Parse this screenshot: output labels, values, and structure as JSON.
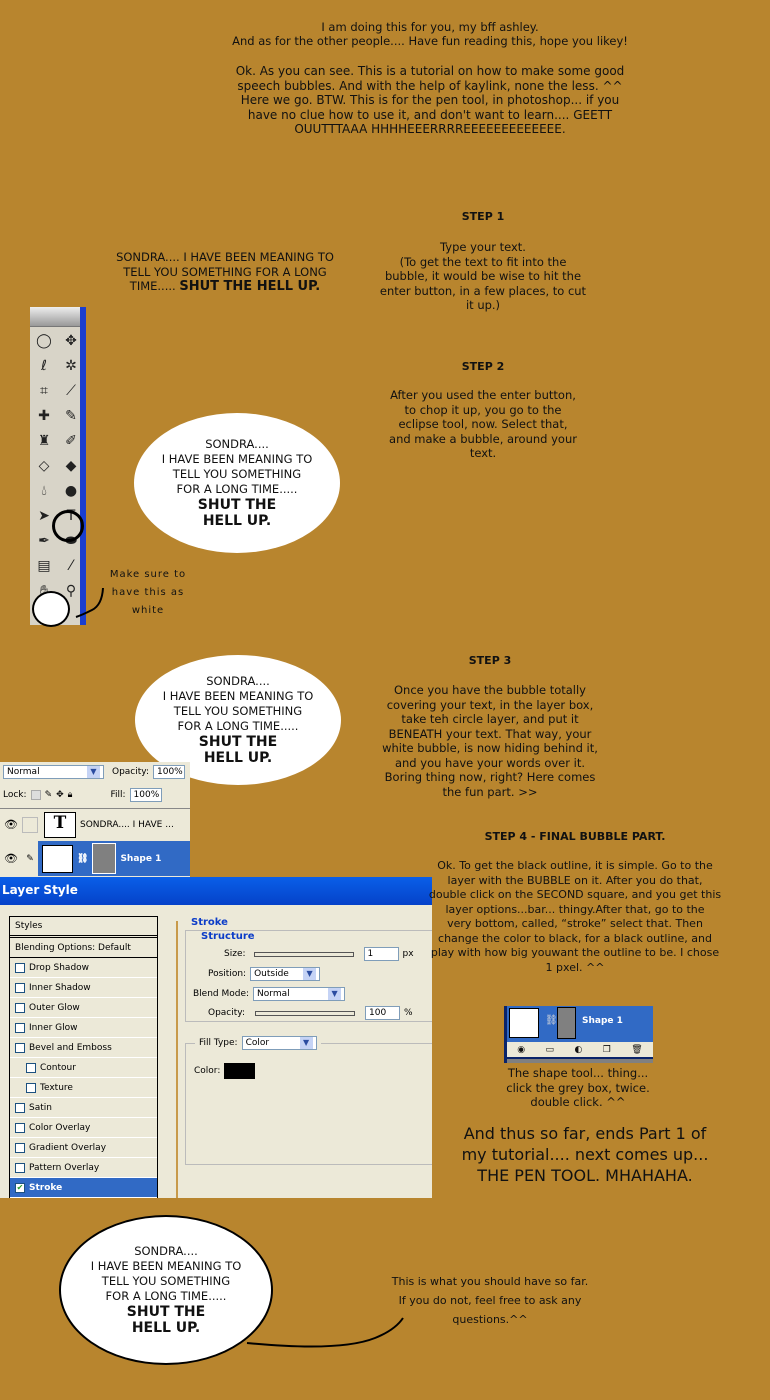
{
  "intro": {
    "line1": "I am doing this for you, my bff ashley.",
    "line2": "And as for the other people.... Have fun reading this, hope you likey!",
    "para": "Ok. As you can see. This is a tutorial on how to make some good\nspeech bubbles. And with the help of kaylink, none the less. ^^\nHere we go. BTW. This is for the pen tool, in photoshop... if you\nhave no clue how to use it, and don't want to learn.... GEETT\nOUUTTTAAA HHHHEEERRRREEEEEEEEEEEEE."
  },
  "sample_text": {
    "plain": "SONDRA.... I HAVE BEEN MEANING TO\nTELL YOU SOMETHING FOR A LONG\nTIME.....",
    "bold": "SHUT THE HELL UP."
  },
  "bubble": {
    "line1": "SONDRA....",
    "line2": "I HAVE BEEN MEANING TO",
    "line3": "TELL YOU SOMETHING",
    "line4": "FOR A LONG TIME.....",
    "bold1": "SHUT THE",
    "bold2": "HELL UP."
  },
  "steps": [
    {
      "title": "STEP 1",
      "text": "Type your text.\n(To get the text to fit into the\nbubble, it would be wise to hit the\nenter button, in a few places, to cut\nit up.)"
    },
    {
      "title": "STEP 2",
      "text": "After you used the enter button,\nto chop it up, you go to the\neclipse tool, now. Select that,\nand make a bubble, around your\ntext."
    },
    {
      "title": "STEP 3",
      "text": "Once you have the bubble totally\ncovering your text, in the layer box,\ntake teh circle layer, and put it\nBENEATH your text. That way, your\nwhite bubble, is now hiding behind it,\nand you have your words over it.\nBoring thing now, right? Here comes\nthe fun part. >>"
    },
    {
      "title": "STEP 4 - FINAL BUBBLE PART.",
      "text": "Ok. To get the black outline, it is simple. Go to the\nlayer with the BUBBLE on it. After you do that,\ndouble click on the SECOND square, and you get this\nlayer options...bar... thingy.After that, go to the\nvery bottom, called, “stroke” select that. Then\nchange the color to black, for a black outline, and\nplay with how big youwant the outline to be. I chose\n1 pxel. ^^"
    }
  ],
  "toolbox_note": "Make sure to\nhave this as\nwhite",
  "toolbox_icons": [
    "marquee-icon",
    "move-icon",
    "lasso-icon",
    "magic-wand-icon",
    "crop-icon",
    "slice-icon",
    "healing-brush-icon",
    "brush-icon",
    "stamp-icon",
    "history-brush-icon",
    "eraser-icon",
    "bucket-icon",
    "blur-icon",
    "dodge-icon",
    "path-select-icon",
    "type-icon",
    "pen-icon",
    "ellipse-icon",
    "notes-icon",
    "eyedropper-icon",
    "hand-icon",
    "zoom-icon"
  ],
  "layers": {
    "blend": "Normal",
    "opacity_label": "Opacity:",
    "opacity": "100%",
    "lock_label": "Lock:",
    "fill_label": "Fill:",
    "fill": "100%",
    "text_layer": "SONDRA.... I HAVE ...",
    "shape_layer": "Shape 1",
    "text_thumb": "T"
  },
  "layer_style": {
    "title": "Layer Style",
    "styles_header": "Styles",
    "blending": "Blending Options: Default",
    "items": [
      {
        "label": "Drop Shadow",
        "checked": false
      },
      {
        "label": "Inner Shadow",
        "checked": false
      },
      {
        "label": "Outer Glow",
        "checked": false
      },
      {
        "label": "Inner Glow",
        "checked": false
      },
      {
        "label": "Bevel and Emboss",
        "checked": false
      },
      {
        "label": "Contour",
        "checked": false
      },
      {
        "label": "Texture",
        "checked": false
      },
      {
        "label": "Satin",
        "checked": false
      },
      {
        "label": "Color Overlay",
        "checked": false
      },
      {
        "label": "Gradient Overlay",
        "checked": false
      },
      {
        "label": "Pattern Overlay",
        "checked": false
      },
      {
        "label": "Stroke",
        "checked": true
      }
    ],
    "stroke": "Stroke",
    "structure": "Structure",
    "size_label": "Size:",
    "size": "1",
    "size_unit": "px",
    "position_label": "Position:",
    "position": "Outside",
    "blend_label": "Blend Mode:",
    "blend": "Normal",
    "opacity_label": "Opacity:",
    "opacity": "100",
    "opacity_unit": "%",
    "filltype_label": "Fill Type:",
    "filltype": "Color",
    "color_label": "Color:",
    "color": "#000000",
    "accent": "#316ac5"
  },
  "shape_caption": "The shape tool... thing...\nclick the grey box, twice.\ndouble click. ^^",
  "ending": "And thus so far, ends Part 1 of\nmy tutorial.... next comes up...\nTHE PEN TOOL. MHAHAHA.",
  "final_note": "This is what you should have so far.\nIf you do not, feel free to ask any\nquestions.^^"
}
